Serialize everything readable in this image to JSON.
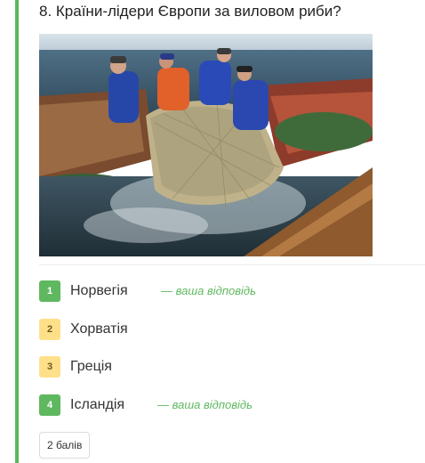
{
  "question": {
    "text": "8. Країни-лідери Європи за виловом риби?"
  },
  "image": {
    "description": "fishermen-hauling-net-of-fish"
  },
  "answers": [
    {
      "number": "1",
      "label": "Норвегія",
      "status": "correct",
      "color": "#5fb85f",
      "note": "— ваша відповідь"
    },
    {
      "number": "2",
      "label": "Хорватія",
      "status": "incorrect",
      "color": "#ffe08a"
    },
    {
      "number": "3",
      "label": "Греція",
      "status": "incorrect",
      "color": "#ffe08a"
    },
    {
      "number": "4",
      "label": "Ісландія",
      "status": "correct",
      "color": "#5fb85f",
      "note": "— ваша відповідь"
    }
  ],
  "points": {
    "label": "2 балів"
  },
  "colors": {
    "accent": "#5bb85d",
    "correct": "#5fb85f",
    "neutral": "#ffe08a"
  }
}
